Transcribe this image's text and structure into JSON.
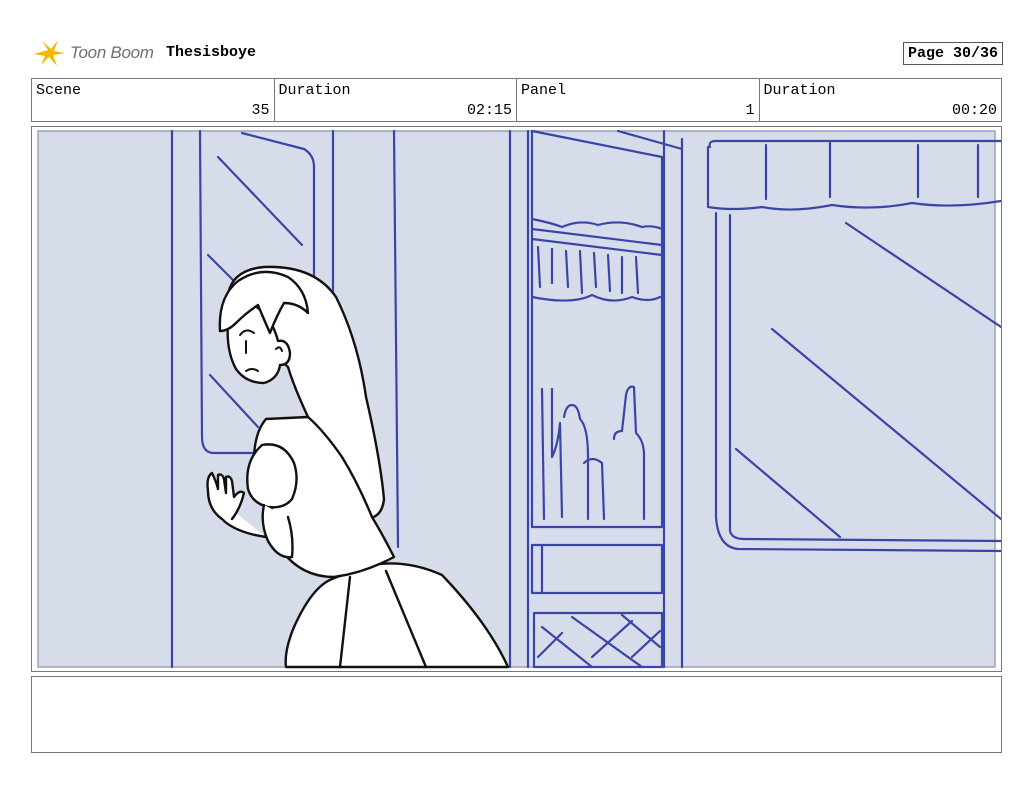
{
  "header": {
    "logo_text": "Toon Boom",
    "project_title": "Thesisboye",
    "page_label": "Page 30/36"
  },
  "info": {
    "scene_label": "Scene",
    "scene_value": "35",
    "duration_label": "Duration",
    "duration_value": "02:15",
    "panel_label": "Panel",
    "panel_value": "1",
    "panel_duration_label": "Duration",
    "panel_duration_value": "00:20"
  },
  "notes": {
    "text": ""
  },
  "colors": {
    "sketch_line": "#3a45a8",
    "panel_fill": "#d7dcea",
    "logo_star": "#f5b800",
    "logo_text": "#6f6f6f"
  }
}
